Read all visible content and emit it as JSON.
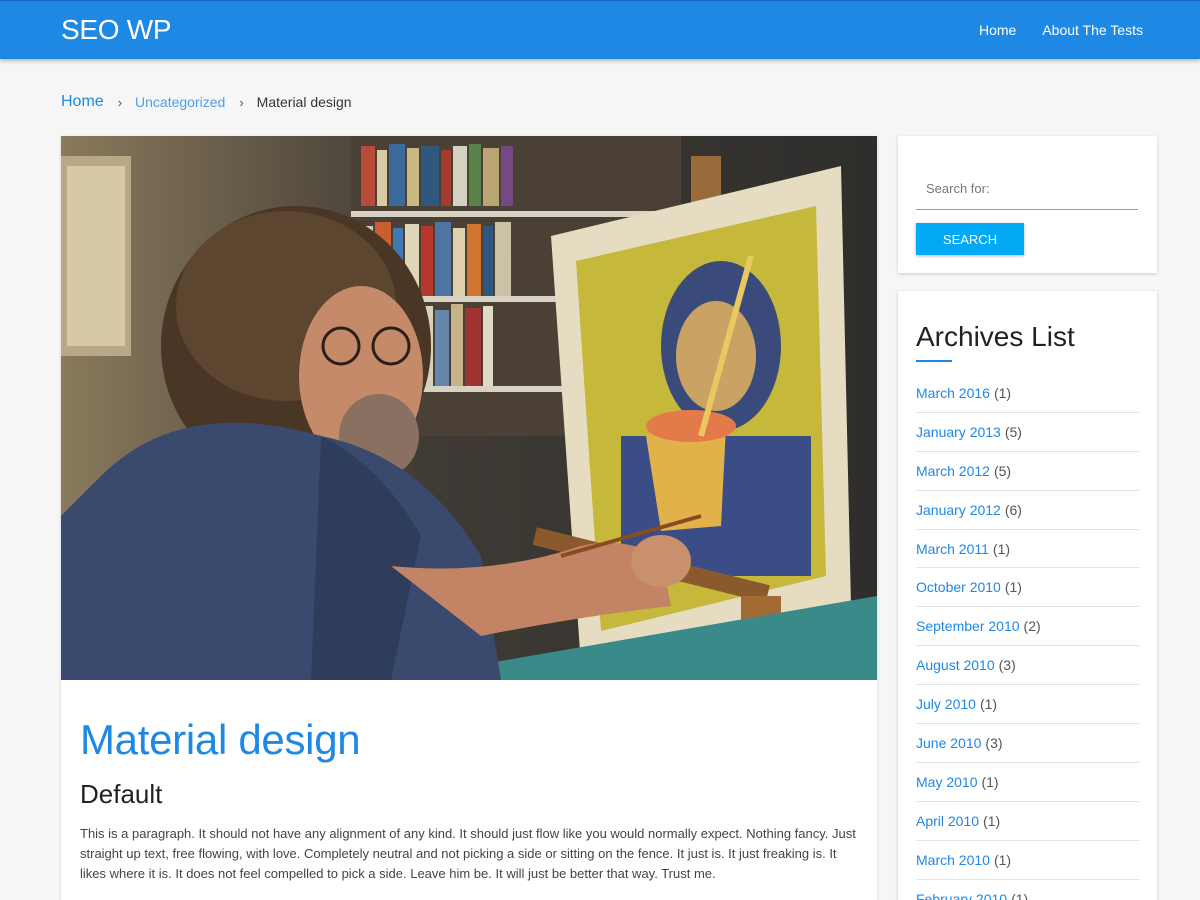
{
  "site": {
    "title": "SEO WP",
    "nav": [
      {
        "label": "Home"
      },
      {
        "label": "About The Tests"
      }
    ]
  },
  "breadcrumb": {
    "home": "Home",
    "separator": "›",
    "category": "Uncategorized",
    "current": "Material design"
  },
  "post": {
    "title": "Material design",
    "subtitle": "Default",
    "paragraph": "This is a paragraph. It should not have any alignment of any kind. It should just flow like you would normally expect. Nothing fancy. Just straight up text, free flowing, with love. Completely neutral and not picking a side or sitting on the fence. It just is. It just freaking is. It likes where it is. It does not feel compelled to pick a side. Leave him be. It will just be better that way. Trust me."
  },
  "search": {
    "placeholder": "Search for:",
    "button": "SEARCH"
  },
  "archives": {
    "title": "Archives List",
    "items": [
      {
        "label": "March 2016",
        "count": "(1)"
      },
      {
        "label": "January 2013",
        "count": "(5)"
      },
      {
        "label": "March 2012",
        "count": "(5)"
      },
      {
        "label": "January 2012",
        "count": "(6)"
      },
      {
        "label": "March 2011",
        "count": "(1)"
      },
      {
        "label": "October 2010",
        "count": "(1)"
      },
      {
        "label": "September 2010",
        "count": "(2)"
      },
      {
        "label": "August 2010",
        "count": "(3)"
      },
      {
        "label": "July 2010",
        "count": "(1)"
      },
      {
        "label": "June 2010",
        "count": "(3)"
      },
      {
        "label": "May 2010",
        "count": "(1)"
      },
      {
        "label": "April 2010",
        "count": "(1)"
      },
      {
        "label": "March 2010",
        "count": "(1)"
      },
      {
        "label": "February 2010",
        "count": "(1)"
      }
    ]
  },
  "colors": {
    "primary": "#1e88e5",
    "search_button": "#03a9f4"
  }
}
